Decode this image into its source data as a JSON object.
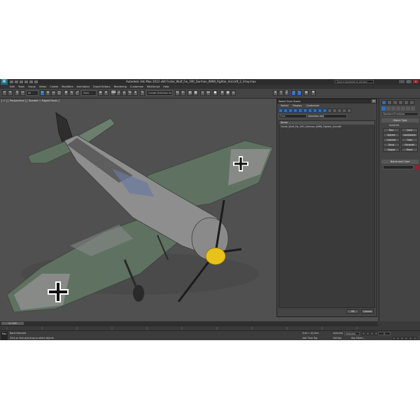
{
  "window": {
    "title": "Autodesk 3ds Max 2012 x64    Focke_Wulf_Fw_190_German_WWII_Fighter_Aircraft_2_Vray.max",
    "search_placeholder": "Type a keyword or phrase",
    "logo": "3ds Max logo"
  },
  "menubar": {
    "items": [
      "Edit",
      "Tools",
      "Group",
      "Views",
      "Create",
      "Modifiers",
      "Animation",
      "Graph Editors",
      "Rendering",
      "Customize",
      "MAXScript",
      "Help"
    ]
  },
  "toolbar": {
    "selection_filter": "All",
    "reference_coord": "View",
    "named_selection": "Create Selection Se"
  },
  "viewport": {
    "label": "[ + ] [ Perspective ] [ Shaded + Edged Faces ]",
    "colors": {
      "background": "#505050",
      "fuselage": "#8e8e8e",
      "camo": "#5f7262",
      "spinner": "#e8c21a"
    }
  },
  "select_dialog": {
    "title": "Select From Scene",
    "close_label": "×",
    "menu": [
      "Select",
      "Display",
      "Customize"
    ],
    "find_label": "Find:",
    "selection_set_label": "Selection Set:",
    "column_header": "Name",
    "items": [
      "Focke_Wulf_Fw_190_German_WWII_Fighter_Aircraft"
    ],
    "ok_label": "OK",
    "cancel_label": "Cancel"
  },
  "command_panel": {
    "category": "Standard Primitives",
    "rollout_object_type": "Object Type",
    "autogrid_label": "AutoGrid",
    "buttons": [
      "Box",
      "Cone",
      "Sphere",
      "GeoSphere",
      "Cylinder",
      "Tube",
      "Torus",
      "Pyramid",
      "Teapot",
      "Plane"
    ],
    "rollout_name_color": "Name and Color",
    "object_color": "#a8172a"
  },
  "timeline": {
    "slider_label": "0 / 100"
  },
  "statusbar": {
    "maxscript_label": "Max",
    "status_text": "None Selected",
    "prompt_text": "Click or click-and-drag to select objects",
    "grid_text": "Grid = 10,0cm",
    "add_time_tag": "Add Time Tag",
    "auto_key_label": "Auto Key",
    "set_key_label": "Set Key",
    "selected_value": "Selected",
    "key_filters_label": "Key Filters...",
    "frame_value": "0"
  }
}
